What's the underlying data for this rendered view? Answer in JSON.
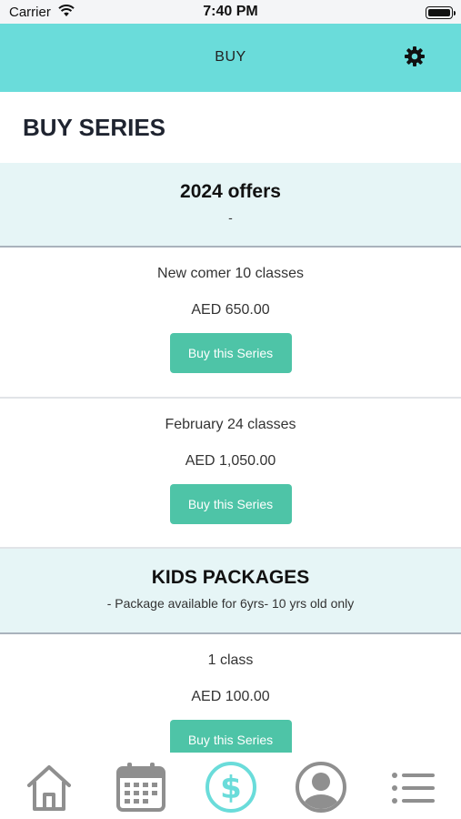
{
  "status_bar": {
    "carrier": "Carrier",
    "time": "7:40 PM"
  },
  "header": {
    "title": "BUY"
  },
  "page": {
    "title": "BUY SERIES"
  },
  "sections": [
    {
      "name": "2024 offers",
      "description": "-",
      "packages": [
        {
          "name": "New comer 10 classes",
          "price": "AED 650.00",
          "button": "Buy this Series"
        },
        {
          "name": "February 24 classes",
          "price": "AED 1,050.00",
          "button": "Buy this Series"
        }
      ]
    },
    {
      "name": "KIDS PACKAGES",
      "description": "- Package available for 6yrs- 10 yrs old only",
      "packages": [
        {
          "name": "1 class",
          "price": "AED 100.00",
          "button": "Buy this Series"
        }
      ]
    }
  ],
  "tab_bar": {
    "active": "buy",
    "icons": [
      "home-icon",
      "calendar-icon",
      "dollar-icon",
      "profile-icon",
      "menu-icon"
    ],
    "active_color": "#6adcda",
    "inactive_color": "#8f8f8f"
  },
  "colors": {
    "header": "#6adcda",
    "button": "#4ec4a7",
    "section_bg": "#e6f5f6"
  }
}
